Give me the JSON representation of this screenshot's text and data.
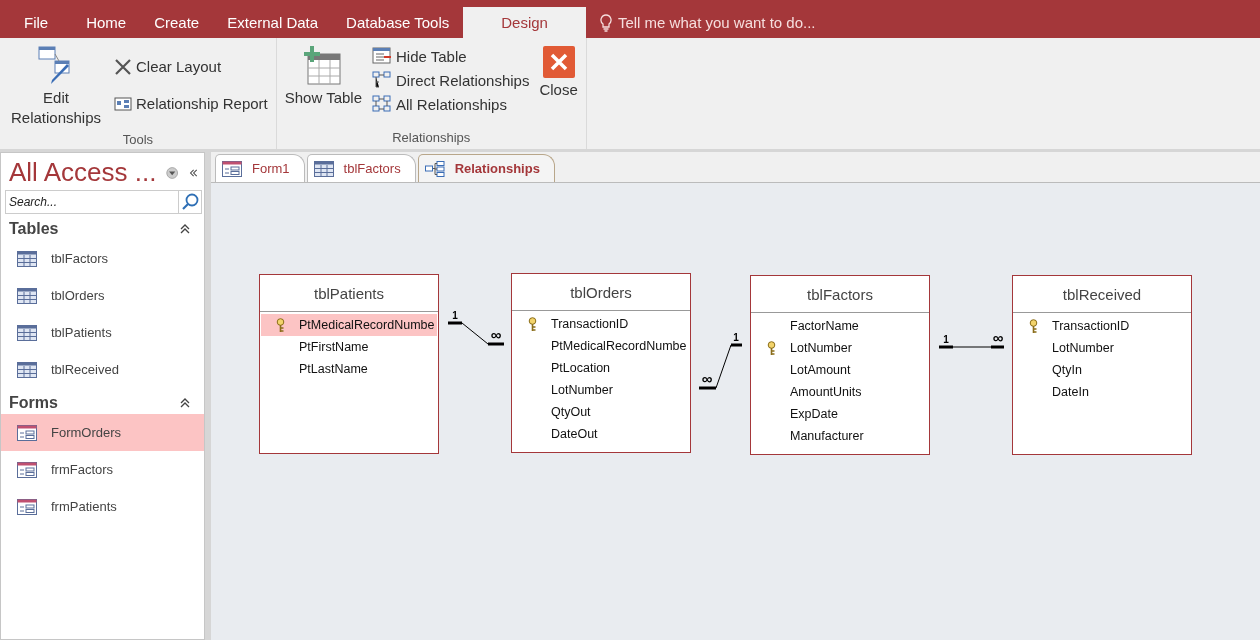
{
  "ribbon_tabs": [
    {
      "label": "File",
      "selected": false
    },
    {
      "label": "Home",
      "selected": false
    },
    {
      "label": "Create",
      "selected": false
    },
    {
      "label": "External Data",
      "selected": false
    },
    {
      "label": "Database Tools",
      "selected": false
    },
    {
      "label": "Design",
      "selected": true
    }
  ],
  "tell_me": {
    "placeholder": "Tell me what you want to do..."
  },
  "ribbon_groups": [
    {
      "label": "Tools",
      "buttons": [
        {
          "label": "Edit Relationships",
          "kind": "large"
        },
        {
          "label": "Clear Layout",
          "kind": "small"
        },
        {
          "label": "Relationship Report",
          "kind": "small"
        }
      ]
    },
    {
      "label": "Relationships",
      "buttons": [
        {
          "label": "Show Table",
          "kind": "large"
        },
        {
          "label": "Hide Table",
          "kind": "small"
        },
        {
          "label": "Direct Relationships",
          "kind": "small"
        },
        {
          "label": "All Relationships",
          "kind": "small"
        },
        {
          "label": "Close",
          "kind": "large"
        }
      ]
    }
  ],
  "nav_pane": {
    "title": "All Access ...",
    "search": {
      "placeholder": "Search..."
    },
    "sections": [
      {
        "title": "Tables",
        "items": [
          {
            "label": "tblFactors",
            "kind": "table",
            "selected": false
          },
          {
            "label": "tblOrders",
            "kind": "table",
            "selected": false
          },
          {
            "label": "tblPatients",
            "kind": "table",
            "selected": false
          },
          {
            "label": "tblReceived",
            "kind": "table",
            "selected": false
          }
        ]
      },
      {
        "title": "Forms",
        "items": [
          {
            "label": "FormOrders",
            "kind": "form",
            "selected": true
          },
          {
            "label": "frmFactors",
            "kind": "form",
            "selected": false
          },
          {
            "label": "frmPatients",
            "kind": "form",
            "selected": false
          }
        ]
      }
    ]
  },
  "document_tabs": [
    {
      "label": "Form1",
      "kind": "form",
      "selected": false
    },
    {
      "label": "tblFactors",
      "kind": "table",
      "selected": false
    },
    {
      "label": "Relationships",
      "kind": "relationships",
      "selected": true
    }
  ],
  "tables": [
    {
      "title": "tblPatients",
      "fields": [
        {
          "name": "PtMedicalRecordNumbe",
          "primary_key": true,
          "selected": true
        },
        {
          "name": "PtFirstName",
          "primary_key": false,
          "selected": false
        },
        {
          "name": "PtLastName",
          "primary_key": false,
          "selected": false
        }
      ]
    },
    {
      "title": "tblOrders",
      "fields": [
        {
          "name": "TransactionID",
          "primary_key": true,
          "selected": false
        },
        {
          "name": "PtMedicalRecordNumbe",
          "primary_key": false,
          "selected": false
        },
        {
          "name": "PtLocation",
          "primary_key": false,
          "selected": false
        },
        {
          "name": "LotNumber",
          "primary_key": false,
          "selected": false
        },
        {
          "name": "QtyOut",
          "primary_key": false,
          "selected": false
        },
        {
          "name": "DateOut",
          "primary_key": false,
          "selected": false
        }
      ]
    },
    {
      "title": "tblFactors",
      "fields": [
        {
          "name": "FactorName",
          "primary_key": false,
          "selected": false
        },
        {
          "name": "LotNumber",
          "primary_key": true,
          "selected": false
        },
        {
          "name": "LotAmount",
          "primary_key": false,
          "selected": false
        },
        {
          "name": "AmountUnits",
          "primary_key": false,
          "selected": false
        },
        {
          "name": "ExpDate",
          "primary_key": false,
          "selected": false
        },
        {
          "name": "Manufacturer",
          "primary_key": false,
          "selected": false
        }
      ]
    },
    {
      "title": "tblReceived",
      "fields": [
        {
          "name": "TransactionID",
          "primary_key": true,
          "selected": false
        },
        {
          "name": "LotNumber",
          "primary_key": false,
          "selected": false
        },
        {
          "name": "QtyIn",
          "primary_key": false,
          "selected": false
        },
        {
          "name": "DateIn",
          "primary_key": false,
          "selected": false
        }
      ]
    }
  ],
  "relationships": [
    {
      "one": "1",
      "many": "∞"
    },
    {
      "one": "1",
      "many": "∞"
    },
    {
      "one": "1",
      "many": "∞"
    }
  ]
}
